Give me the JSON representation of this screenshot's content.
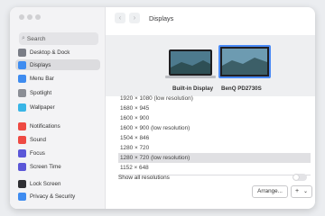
{
  "sidebar": {
    "search_icon": "search-icon",
    "search_placeholder": "Search",
    "items": [
      {
        "label": "Desktop & Dock",
        "icon": "dock-icon",
        "color": "#7a7d86"
      },
      {
        "label": "Displays",
        "icon": "display-icon",
        "color": "#3f8cf0"
      },
      {
        "label": "Menu Bar",
        "icon": "menubar-icon",
        "color": "#3f8cf0"
      },
      {
        "label": "Spotlight",
        "icon": "spotlight-icon",
        "color": "#8b8e95"
      },
      {
        "label": "Wallpaper",
        "icon": "wallpaper-icon",
        "color": "#39b5e6"
      },
      {
        "label": "Notifications",
        "icon": "bell-icon",
        "color": "#ee4a43"
      },
      {
        "label": "Sound",
        "icon": "speaker-icon",
        "color": "#ee4a43"
      },
      {
        "label": "Focus",
        "icon": "moon-icon",
        "color": "#5b57d8"
      },
      {
        "label": "Screen Time",
        "icon": "hourglass-icon",
        "color": "#5b57d8"
      },
      {
        "label": "Lock Screen",
        "icon": "lock-icon",
        "color": "#2f2f33"
      },
      {
        "label": "Privacy & Security",
        "icon": "hand-icon",
        "color": "#3f8cf0"
      }
    ]
  },
  "toolbar": {
    "back_glyph": "‹",
    "forward_glyph": "›",
    "title": "Displays"
  },
  "displays": {
    "builtin_label": "Built-in Display",
    "external_label": "BenQ PD2730S"
  },
  "resolutions": [
    "1920 × 1080 (low resolution)",
    "1680 × 945",
    "1600 × 900",
    "1600 × 900 (low resolution)",
    "1504 × 846",
    "1280 × 720",
    "1280 × 720 (low resolution)",
    "1152 × 648"
  ],
  "selected_resolution_index": 6,
  "show_all_label": "Show all resolutions",
  "show_all_on": false,
  "bottom": {
    "arrange_label": "Arrange...",
    "add_label": "+",
    "add_chevron": "⌄"
  }
}
